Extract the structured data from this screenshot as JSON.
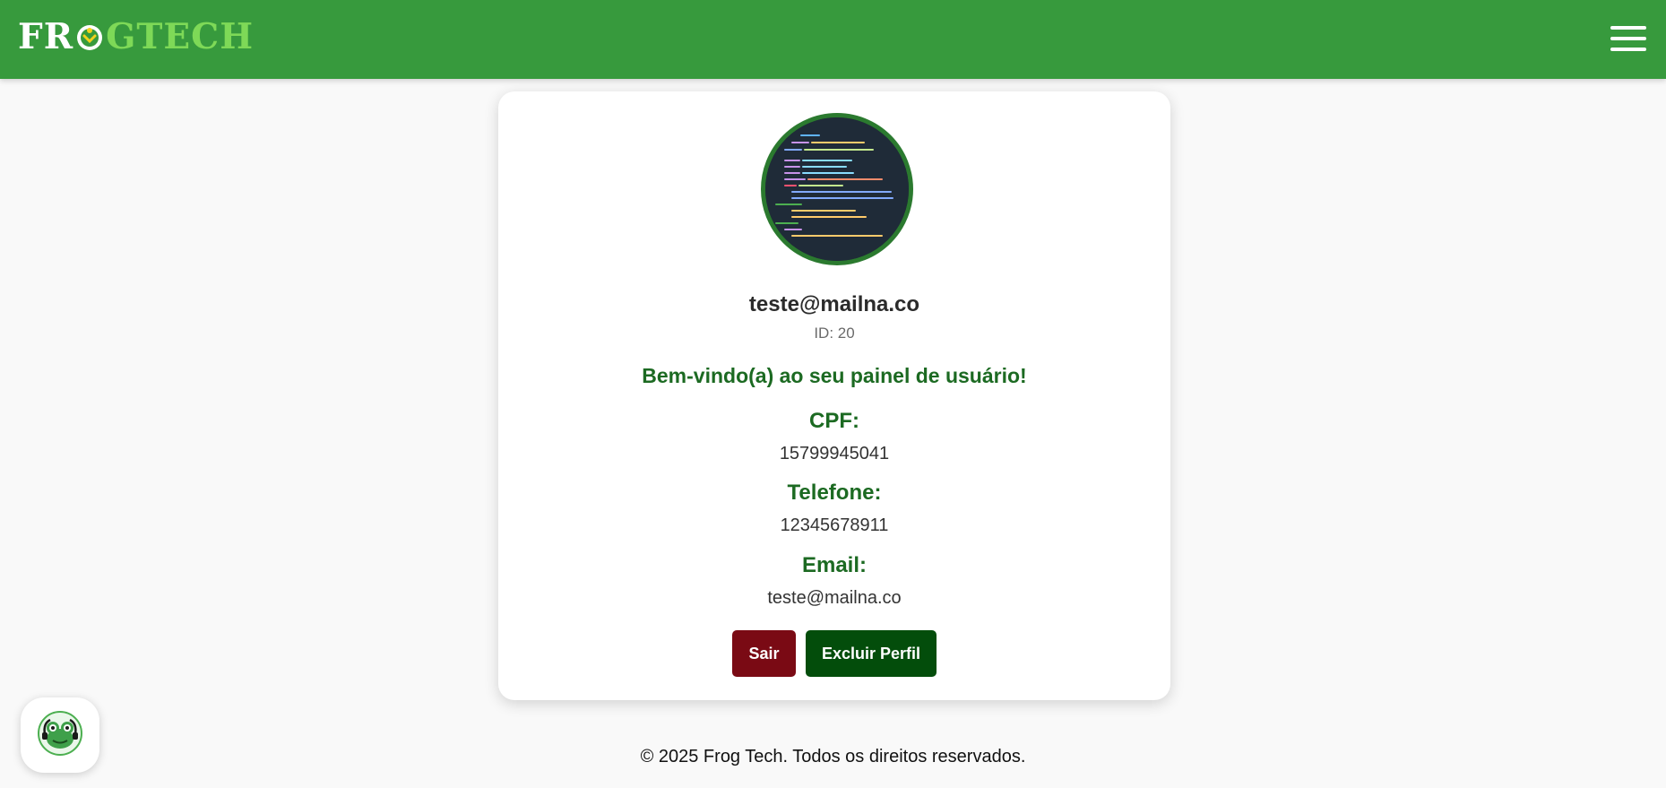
{
  "header": {
    "logo": {
      "part_a": "FR",
      "part_b": "GTECH"
    },
    "menu_icon": "hamburger-menu-icon",
    "background_color": "#379a3d"
  },
  "profile": {
    "avatar_icon": "code-avatar-image",
    "email_title": "teste@mailna.co",
    "id_text": "ID: 20",
    "welcome_text": "Bem-vindo(a) ao seu painel de usuário!",
    "fields": [
      {
        "label": "CPF:",
        "value": "15799945041"
      },
      {
        "label": "Telefone:",
        "value": "12345678911"
      },
      {
        "label": "Email:",
        "value": "teste@mailna.co"
      }
    ],
    "buttons": {
      "logout_label": "Sair",
      "delete_label": "Excluir Perfil"
    },
    "colors": {
      "heading_green": "#1c6a22",
      "logout_red": "#7a0a14",
      "delete_green": "#034d0b"
    }
  },
  "footer": {
    "copyright": "© 2025 Frog Tech. Todos os direitos reservados."
  },
  "chat": {
    "icon": "frog-assistant-icon"
  }
}
